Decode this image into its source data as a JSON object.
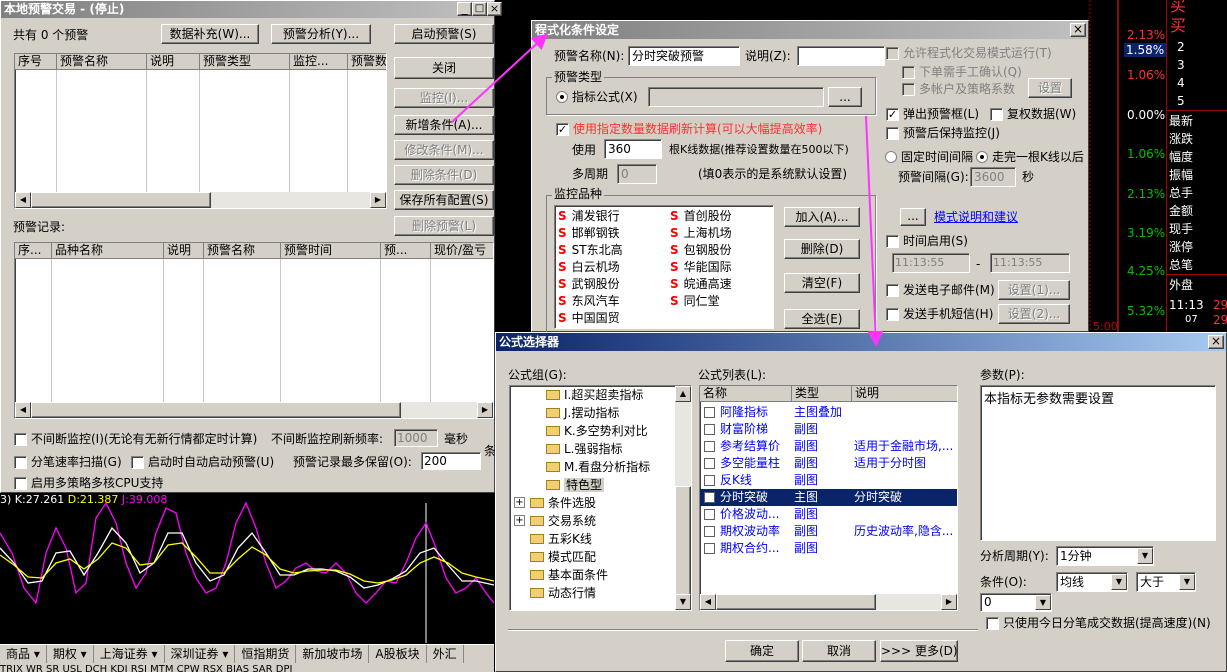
{
  "left_window": {
    "title": "本地预警交易 - (停止)",
    "count_label": "共有 0 个预警",
    "btn_supplement": "数据补充(W)...",
    "btn_analysis": "预警分析(Y)...",
    "btn_start": "启动预警(S)",
    "btn_close": "关闭",
    "btn_monitor": "监控(I)...",
    "btn_add": "新增条件(A)...",
    "btn_modify": "修改条件(M)...",
    "btn_delete_cond": "删除条件(D)",
    "btn_save_all": "保存所有配置(S)",
    "btn_delete_warn": "删除预警(L)",
    "warn_cols": [
      "序号",
      "预警名称",
      "说明",
      "预警类型",
      "监控...",
      "预警数"
    ],
    "record_label": "预警记录:",
    "record_cols": [
      "序...",
      "品种名称",
      "说明",
      "预警名称",
      "预警时间",
      "预...",
      "现价/盈亏"
    ],
    "chk_continuous": "不间断监控(I)(无论有无新行情都定时计算)",
    "freq_label": "不间断监控刷新频率:",
    "freq_value": "1000",
    "freq_unit": "毫秒",
    "chk_tick": "分笔速率扫描(G)",
    "chk_autostart": "启动时自动启动预警(U)",
    "max_keep_label": "预警记录最多保留(O):",
    "max_keep_value": "200",
    "max_keep_unit": "条",
    "chk_cpu": "启用多策略多核CPU支持"
  },
  "indicator": {
    "prefix": "3)",
    "k": "K:27.261",
    "d": "D:21.387",
    "j": "J:39.008"
  },
  "bottom_tabs": [
    "商品 ▾",
    "期权 ▾",
    "上海证券 ▾",
    "深圳证券 ▾",
    "恒指期货",
    "新加坡市场",
    "A股板块",
    "外汇"
  ],
  "bottom_row2": "TRIX  WR  SR  USL  DCH  KDJ  RSI  MTM  CPW  RSX  BIAS  SAR  DPI",
  "right_quote": {
    "buy_sell": [
      "买",
      "买"
    ],
    "levels": [
      "2",
      "3",
      "4",
      "5"
    ],
    "labels": [
      "最新",
      "涨跌",
      "幅度",
      "振幅",
      "总手",
      "金额",
      "现手",
      "涨停",
      "总笔",
      "外盘"
    ],
    "pcts": [
      "2.13%",
      "1.58%",
      "1.06%",
      "0.00%",
      "1.06%",
      "2.13%",
      "3.19%",
      "4.25%",
      "5.32%"
    ],
    "time": "11:13",
    "time_sub": "07",
    "small_nums": [
      "29",
      "29"
    ],
    "time_tick": "5:00"
  },
  "program_dialog": {
    "title": "程式化条件设定",
    "name_label": "预警名称(N):",
    "name_value": "分时突破预警",
    "desc_label": "说明(Z):",
    "desc_value": "",
    "allow_prog": "允许程式化交易模式运行(T)",
    "manual_confirm": "下单需手工确认(Q)",
    "multi_account": "多帐户及策略系数",
    "btn_settings": "设置",
    "type_group": "预警类型",
    "radio_formula": "指标公式(X)",
    "btn_ellipsis": "...",
    "popup": "弹出预警框(L)",
    "rights": "复权数据(W)",
    "keep_monitor": "预警后保持监控(J)",
    "use_count": "使用指定数量数据刷新计算(可以大幅提高效率)",
    "use_label": "使用",
    "use_value": "360",
    "use_suffix": "根K线数据(推荐设置数量在500以下)",
    "multi_period_label": "多周期",
    "multi_period_value": "0",
    "multi_period_hint": "(填0表示的是系统默认设置)",
    "fixed_interval": "固定时间间隔",
    "kline_after": "走完一根K线以后",
    "interval_label": "预警间隔(G):",
    "interval_value": "3600",
    "interval_unit": "秒",
    "monitor_group": "监控品种",
    "stocks_col1": [
      "浦发银行",
      "邯郸钢铁",
      "ST东北高",
      "白云机场",
      "武钢股份",
      "东风汽车",
      "中国国贸"
    ],
    "stocks_col2": [
      "首创股份",
      "上海机场",
      "包钢股份",
      "华能国际",
      "皖通高速",
      "同仁堂"
    ],
    "btn_add": "加入(A)...",
    "btn_delete": "删除(D)",
    "btn_clear": "清空(F)",
    "btn_select_all": "全选(E)",
    "mode_link": "模式说明和建议",
    "time_enable": "时间启用(S)",
    "time_start": "11:13:55",
    "time_end": "11:13:55",
    "send_email": "发送电子邮件(M)",
    "btn_email_set": "设置(1)...",
    "send_sms": "发送手机短信(H)",
    "btn_sms_set": "设置(2)...",
    "close_glyph": "×"
  },
  "formula_dialog": {
    "title": "公式选择器",
    "group_label": "公式组(G):",
    "tree": [
      "I.超买超卖指标",
      "J.摆动指标",
      "K.多空势利对比",
      "L.强弱指标",
      "M.看盘分析指标",
      "特色型",
      "条件选股",
      "交易系统",
      "五彩K线",
      "模式匹配",
      "基本面条件",
      "动态行情"
    ],
    "list_label": "公式列表(L):",
    "list_cols": [
      "名称",
      "类型",
      "说明"
    ],
    "list_rows": [
      [
        "阿隆指标",
        "主图叠加",
        ""
      ],
      [
        "财富阶梯",
        "副图",
        ""
      ],
      [
        "参考结算价",
        "副图",
        "适用于金融市场,..."
      ],
      [
        "多空能量柱",
        "副图",
        "适用于分时图"
      ],
      [
        "反K线",
        "副图",
        ""
      ],
      [
        "分时突破",
        "主图",
        "分时突破"
      ],
      [
        "价格波动...",
        "副图",
        ""
      ],
      [
        "期权波动率",
        "副图",
        "历史波动率,隐含..."
      ],
      [
        "期权合约...",
        "副图",
        ""
      ]
    ],
    "selected_index": 5,
    "param_label": "参数(P):",
    "param_text": "本指标无参数需要设置",
    "period_label": "分析周期(Y):",
    "period_value": "1分钟",
    "cond_label": "条件(O):",
    "cond_value": "均线",
    "cond_op": "大于",
    "cond_num": "0",
    "only_today": "只使用今日分笔成交数据(提高速度)(N)",
    "btn_ok": "确定",
    "btn_cancel": "取消",
    "btn_more": ">>> 更多(D)",
    "close_glyph": "×"
  },
  "colors": {
    "arrow": "#ff33ff",
    "title_active": "#0a246a",
    "select": "#0a246a",
    "link": "#0000ff",
    "stock_s": "#ff0000",
    "chart_k": "#ffffff",
    "chart_d": "#ffff00",
    "chart_j": "#ff00ff"
  }
}
